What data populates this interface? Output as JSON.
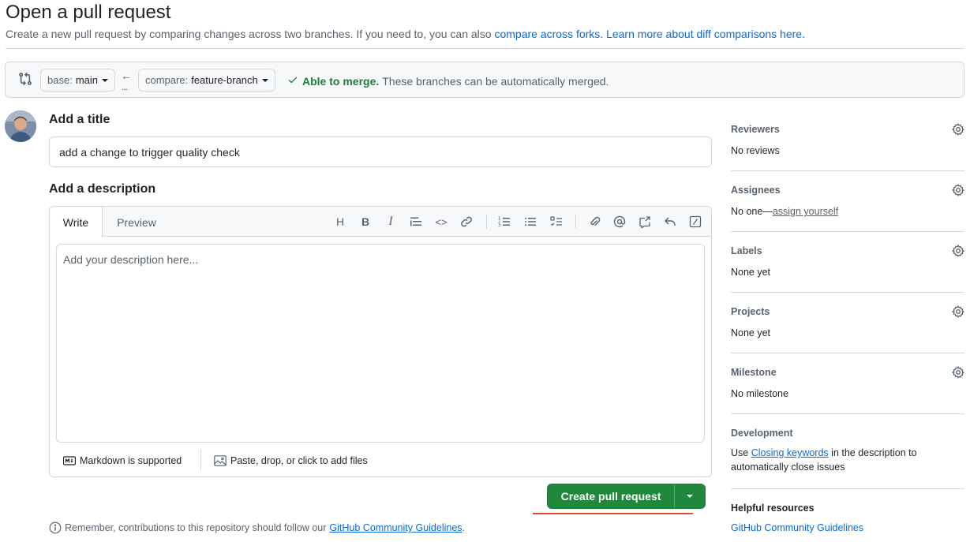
{
  "header": {
    "title": "Open a pull request",
    "subtitle_text": "Create a new pull request by comparing changes across two branches. If you need to, you can also ",
    "link_forks": "compare across forks.",
    "link_learn": "Learn more about diff comparisons here."
  },
  "compare": {
    "base_prefix": "base:",
    "base_branch": "main",
    "arrow": "←",
    "dots": "...",
    "compare_prefix": "compare:",
    "compare_branch": "feature-branch",
    "merge_status": "Able to merge.",
    "merge_desc": "These branches can be automatically merged."
  },
  "form": {
    "title_label": "Add a title",
    "title_value": "add a change to trigger quality check",
    "description_label": "Add a description",
    "tab_write": "Write",
    "tab_preview": "Preview",
    "description_placeholder": "Add your description here...",
    "markdown_note": "Markdown is supported",
    "attach_note": "Paste, drop, or click to add files",
    "submit_label": "Create pull request",
    "remember_text": "Remember, contributions to this repository should follow our",
    "remember_link": "GitHub Community Guidelines",
    "remember_end": "."
  },
  "toolbar": {
    "heading": "H",
    "bold": "B",
    "italic": "I",
    "code": "<>"
  },
  "sidebar": {
    "reviewers": {
      "label": "Reviewers",
      "value": "No reviews"
    },
    "assignees": {
      "label": "Assignees",
      "value_prefix": "No one—",
      "value_link": "assign yourself"
    },
    "labels": {
      "label": "Labels",
      "value": "None yet"
    },
    "projects": {
      "label": "Projects",
      "value": "None yet"
    },
    "milestone": {
      "label": "Milestone",
      "value": "No milestone"
    },
    "development": {
      "label": "Development",
      "prefix": "Use ",
      "link": "Closing keywords",
      "suffix": " in the description to automatically close issues"
    },
    "helpful": {
      "label": "Helpful resources",
      "link": "GitHub Community Guidelines"
    }
  },
  "colors": {
    "accent": "#0969da",
    "success": "#1a7f37",
    "primary_button": "#1f883d",
    "annotation_underline": "#e5472d"
  }
}
